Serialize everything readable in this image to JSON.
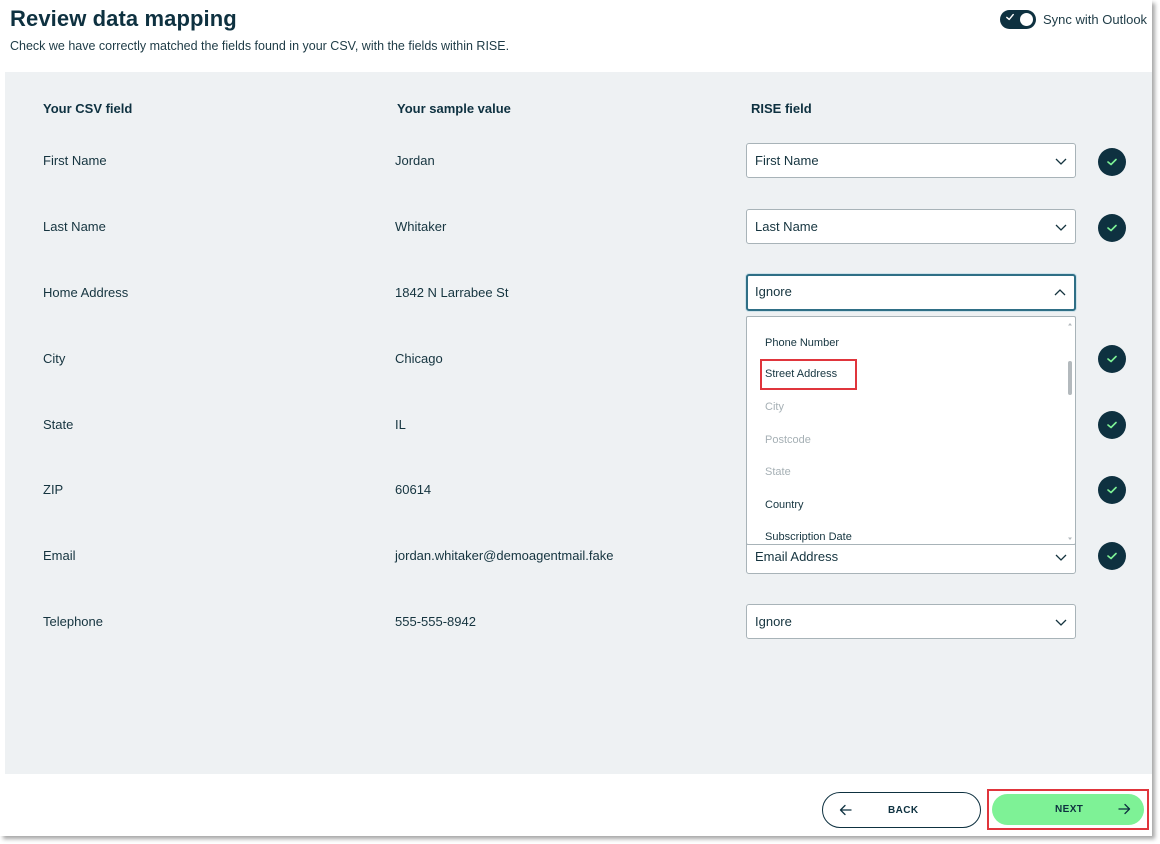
{
  "header": {
    "title": "Review data mapping",
    "subtitle": "Check we have correctly matched the fields found in your CSV, with the fields within RISE.",
    "sync_label": "Sync with Outlook",
    "sync_enabled": true
  },
  "table": {
    "headers": {
      "csv": "Your CSV field",
      "sample": "Your sample value",
      "rise": "RISE field"
    },
    "rows": [
      {
        "csv": "First Name",
        "sample": "Jordan",
        "rise": "First Name",
        "matched": true
      },
      {
        "csv": "Last Name",
        "sample": "Whitaker",
        "rise": "Last Name",
        "matched": true
      },
      {
        "csv": "Home Address",
        "sample": "1842 N Larrabee St",
        "rise": "Ignore",
        "matched": false,
        "open": true
      },
      {
        "csv": "City",
        "sample": "Chicago",
        "rise": "",
        "matched": true
      },
      {
        "csv": "State",
        "sample": "IL",
        "rise": "",
        "matched": true
      },
      {
        "csv": "ZIP",
        "sample": "60614",
        "rise": "",
        "matched": true
      },
      {
        "csv": "Email",
        "sample": "jordan.whitaker@demoagentmail.fake",
        "rise": "Email Address",
        "matched": true
      },
      {
        "csv": "Telephone",
        "sample": "555-555-8942",
        "rise": "Ignore",
        "matched": false
      }
    ]
  },
  "dropdown": {
    "options": [
      {
        "label": "Phone Number",
        "disabled": false
      },
      {
        "label": "Street Address",
        "disabled": false,
        "highlighted": true
      },
      {
        "label": "City",
        "disabled": true
      },
      {
        "label": "Postcode",
        "disabled": true
      },
      {
        "label": "State",
        "disabled": true
      },
      {
        "label": "Country",
        "disabled": false
      },
      {
        "label": "Subscription Date",
        "disabled": false
      }
    ]
  },
  "footer": {
    "back_label": "BACK",
    "next_label": "NEXT"
  },
  "colors": {
    "navy": "#0e3140",
    "panel": "#eef1f3",
    "next_green": "#7ef296",
    "highlight_red": "#e0353c",
    "check_green": "#7ef296"
  },
  "icons": {
    "status": "check-icon",
    "select": "chevron-down-icon",
    "open_select": "chevron-up-icon",
    "back": "arrow-left-icon",
    "next": "arrow-right-icon"
  }
}
